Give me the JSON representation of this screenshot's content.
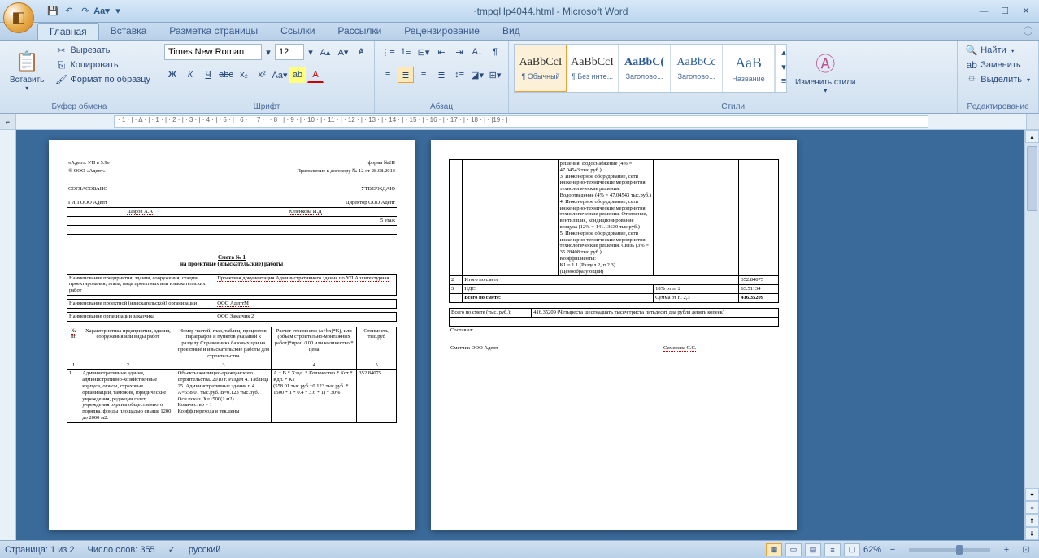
{
  "title": "~tmpqHp4044.html - Microsoft Word",
  "tabs": {
    "home": "Главная",
    "insert": "Вставка",
    "layout": "Разметка страницы",
    "refs": "Ссылки",
    "mail": "Рассылки",
    "review": "Рецензирование",
    "view": "Вид"
  },
  "clipboard": {
    "paste": "Вставить",
    "cut": "Вырезать",
    "copy": "Копировать",
    "format": "Формат по образцу",
    "label": "Буфер обмена"
  },
  "font": {
    "name": "Times New Roman",
    "size": "12",
    "label": "Шрифт"
  },
  "paragraph": {
    "label": "Абзац"
  },
  "styles": {
    "label": "Стили",
    "change": "Изменить стили",
    "items": [
      {
        "prev": "AaBbCcI",
        "name": "¶ Обычный"
      },
      {
        "prev": "AaBbCcI",
        "name": "¶ Без инте..."
      },
      {
        "prev": "AaBbC(",
        "name": "Заголово..."
      },
      {
        "prev": "AaBbCc",
        "name": "Заголово..."
      },
      {
        "prev": "АаВ",
        "name": "Название"
      }
    ]
  },
  "editing": {
    "find": "Найти",
    "replace": "Заменить",
    "select": "Выделить",
    "label": "Редактирование"
  },
  "ruler_text": "· 1 · | · Δ · | · 1 · | · 2 · | · 3 · | · 4 · | · 5 · | · 6 · | · 7 · | · 8 · | · 9 · | · 10 · | · 11 · | · 12 · | · 13 · | · 14 · | · 15 · | · 16 · | · 17 · | · 18 · | · |19 · |",
  "doc_p1": {
    "hdr_left": "«Адепт: УП в 5.9»",
    "hdr_right": "форма №2П",
    "org": "® ООО «Адепт»",
    "app": "Приложение к договору № 12 от 28.08.2013",
    "agree": "СОГЛАСОВАНО",
    "approve": "УТВЕРЖДАЮ",
    "gip": "ГИП ООО Адепт",
    "dir": "Директор ООО Адепт",
    "p1": "Шаров А.А",
    "p2": "Юленкова И.Д",
    "stamp": "5 этаж",
    "title1": "Смета № 1",
    "title2": "на проектные (изыскательские) работы",
    "r1a": "Наименование предприятия, здания, сооружения, стадии проектирования, этапа, вида проектных или изыскательских работ",
    "r1b": "Проектная документация Административного здания по УП Архитектурная",
    "r2a": "Наименование проектной (изыскательской) организации",
    "r2b": "ООО АдептМ",
    "r3a": "Наименование организации заказчика",
    "r3b": "ООО Заказчик 2",
    "th1": "№ пп",
    "th2": "Характеристика предприятия, здания, сооружения или виды работ",
    "th3": "Номер частей, глав, таблиц, процентов, параграфов и пунктов указаний к разделу Справочника базовых цен на проектные и изыскательские работы для строительства",
    "th4": "Расчет стоимости: (a+bx)*Kj, или (объем строительно-монтажных работ)*проц./100 или количество * цена",
    "th5": "Стоимость, тыс.руб",
    "n1": "1",
    "n2": "2",
    "n3": "3",
    "n4": "4",
    "n5": "5",
    "td1_1": "1",
    "td1_2": "Административные здания, административно-хозяйственные корпуса, офисы, страховые организации, таможни, юридические учреждения, редакции газет, учреждения охраны общественного порядка, фонды площадью свыше 1200 до 2000 м2.",
    "td1_3": "Объекты жилищно-гражданского строительства. 2010 г. Раздел 4. Таблица 25. Административные здания п.4\nА=558.01 тыс.руб. В=0.123 тыс.руб.\nОсн.показ. X=1500(1 м2)\nКоличество = 1\nКоэфф.перехода в тек.цены",
    "td1_4": "А + В * Хзад. * Количество * Кст * Кдл. * К1\n(558.01 тыс.руб.+0.123 тыс.руб. * 1500 * 1 * 0.4 * 3.6 * 1) * 30%",
    "td1_5": "352.84075"
  },
  "doc_p2": {
    "eng_text": "решения. Водоснабжение (4% = 47.04543 тыс.руб.)\n3. Инженерное оборудование, сети инженерно-технические мероприятия, технологические решения. Водоотведение (4% = 47.04543 тыс.руб.)\n4. Инженерное оборудование, сети инженерно-технические мероприятия, технологические решения. Отопление, вентиляция, кондиционирование воздуха (12% = 141.13630 тыс.руб.)\n5. Инженерное оборудование, сети инженерно-технические мероприятия, технологические решения. Связь (3% = 35.28408 тыс.руб.)\nКоэффициенты:\nК1 = 1.1 (Раздел 2, п.2.3) (Ценообразующий)",
    "r2n": "2",
    "r2t": "Итого по смете",
    "r2v": "352.84075",
    "r3n": "3",
    "r3t": "НДС",
    "r3p": "18% от п. 2",
    "r3v": "63.51134",
    "r4t": "Всего по смете:",
    "r4p": "Сумма от п. 2,3",
    "r4v": "416.35209",
    "total_lbl": "Всего по смете (тыс. руб.):",
    "total_val": "416.35209 (Четыреста шестнадцать тысяч триста пятьдесят два рубля девять копеек)",
    "compiled": "Составил:",
    "smet": "Сметчик ООО Адепт",
    "smet_p": "Семенова С.С."
  },
  "status": {
    "page": "Страница: 1 из 2",
    "words": "Число слов: 355",
    "lang": "русский",
    "zoom": "62%"
  }
}
